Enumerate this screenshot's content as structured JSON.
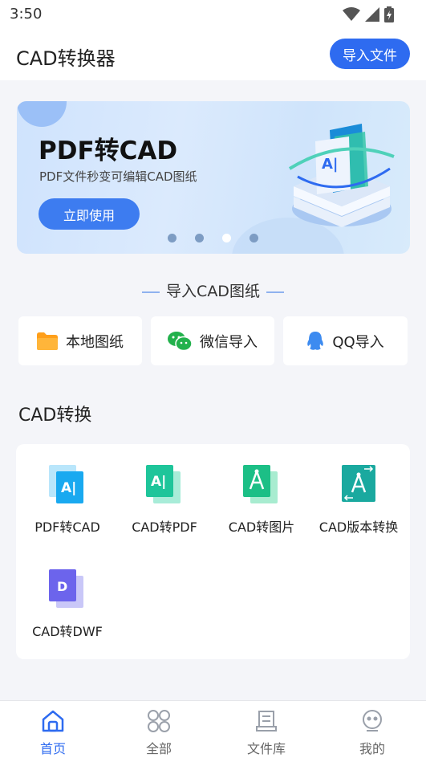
{
  "status_bar": {
    "time": "3:50"
  },
  "header": {
    "title": "CAD转换器",
    "import_button": "导入文件"
  },
  "banner": {
    "title": "PDF转CAD",
    "subtitle": "PDF文件秒变可编辑CAD图纸",
    "button": "立即使用",
    "slide_count": 4,
    "active_slide": 3
  },
  "import_section": {
    "heading": "导入CAD图纸",
    "items": [
      {
        "label": "本地图纸",
        "icon": "folder-icon"
      },
      {
        "label": "微信导入",
        "icon": "wechat-icon"
      },
      {
        "label": "QQ导入",
        "icon": "qq-icon"
      }
    ]
  },
  "convert_section": {
    "title": "CAD转换",
    "tools": [
      {
        "label": "PDF转CAD",
        "icon": "pdf-to-cad-icon"
      },
      {
        "label": "CAD转PDF",
        "icon": "cad-to-pdf-icon"
      },
      {
        "label": "CAD转图片",
        "icon": "cad-to-image-icon"
      },
      {
        "label": "CAD版本转换",
        "icon": "cad-version-convert-icon"
      },
      {
        "label": "CAD转DWF",
        "icon": "cad-to-dwf-icon"
      }
    ]
  },
  "bottom_nav": {
    "items": [
      {
        "label": "首页",
        "icon": "home-icon",
        "active": true
      },
      {
        "label": "全部",
        "icon": "grid-icon",
        "active": false
      },
      {
        "label": "文件库",
        "icon": "file-library-icon",
        "active": false
      },
      {
        "label": "我的",
        "icon": "profile-icon",
        "active": false
      }
    ]
  },
  "colors": {
    "accent": "#2e6bf0",
    "background": "#f4f5f9"
  }
}
